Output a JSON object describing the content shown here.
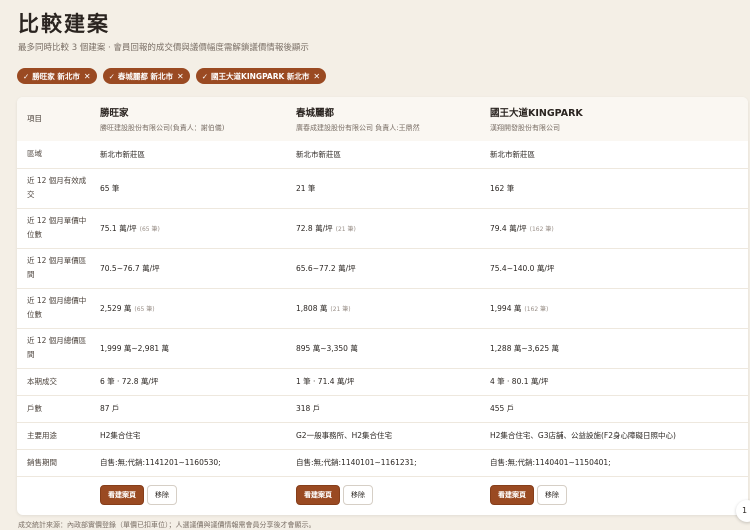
{
  "page": {
    "title": "比較建案",
    "subtitle": "最多同時比較 3 個建案 · 會員回報的成交價與議價幅度需解鎖議價情報後顯示",
    "footnote": "成交統計來源：內政部實價登錄（單價已扣車位）；人選議價與議價情報需會員分享後才會顯示。",
    "badge": "1"
  },
  "chips": [
    {
      "label": "勝旺家 新北市",
      "check": "✓",
      "close": "✕"
    },
    {
      "label": "春城麗都 新北市",
      "check": "✓",
      "close": "✕"
    },
    {
      "label": "國王大道KINGPARK 新北市",
      "check": "✓",
      "close": "✕"
    }
  ],
  "table": {
    "item_header": "項目",
    "projects": [
      {
        "name": "勝旺家",
        "developer": "勝旺建設股份有限公司(負責人：謝伯儀)"
      },
      {
        "name": "春城麗都",
        "developer": "廣春成建設股份有限公司 負責人:王鼎然"
      },
      {
        "name": "國王大道KINGPARK",
        "developer": "漢翔開發股份有限公司"
      }
    ],
    "rows": [
      {
        "label": "區域",
        "values": [
          {
            "v": "新北市新莊區"
          },
          {
            "v": "新北市新莊區"
          },
          {
            "v": "新北市新莊區"
          }
        ]
      },
      {
        "label": "近 12 個月有效成交",
        "values": [
          {
            "v": "65 筆"
          },
          {
            "v": "21 筆"
          },
          {
            "v": "162 筆"
          }
        ]
      },
      {
        "label": "近 12 個月單價中位數",
        "values": [
          {
            "v": "75.1 萬/坪",
            "n": "(65 筆)"
          },
          {
            "v": "72.8 萬/坪",
            "n": "(21 筆)"
          },
          {
            "v": "79.4 萬/坪",
            "n": "(162 筆)"
          }
        ]
      },
      {
        "label": "近 12 個月單價區間",
        "values": [
          {
            "v": "70.5~76.7 萬/坪"
          },
          {
            "v": "65.6~77.2 萬/坪"
          },
          {
            "v": "75.4~140.0 萬/坪"
          }
        ]
      },
      {
        "label": "近 12 個月總價中位數",
        "values": [
          {
            "v": "2,529 萬",
            "n": "(65 筆)"
          },
          {
            "v": "1,808 萬",
            "n": "(21 筆)"
          },
          {
            "v": "1,994 萬",
            "n": "(162 筆)"
          }
        ]
      },
      {
        "label": "近 12 個月總價區間",
        "values": [
          {
            "v": "1,999 萬~2,981 萬"
          },
          {
            "v": "895 萬~3,350 萬"
          },
          {
            "v": "1,288 萬~3,625 萬"
          }
        ]
      },
      {
        "label": "本期成交",
        "values": [
          {
            "v": "6 筆 · 72.8 萬/坪"
          },
          {
            "v": "1 筆 · 71.4 萬/坪"
          },
          {
            "v": "4 筆 · 80.1 萬/坪"
          }
        ]
      },
      {
        "label": "戶數",
        "values": [
          {
            "v": "87 戶"
          },
          {
            "v": "318 戶"
          },
          {
            "v": "455 戶"
          }
        ]
      },
      {
        "label": "主要用途",
        "values": [
          {
            "v": "H2集合住宅"
          },
          {
            "v": "G2一般事務所、H2集合住宅"
          },
          {
            "v": "H2集合住宅、G3店舖、公益設施(F2身心障礙日照中心)"
          }
        ]
      },
      {
        "label": "銷售期間",
        "values": [
          {
            "v": "自售:無;代銷:1141201~1160530;"
          },
          {
            "v": "自售:無;代銷:1140101~1161231;"
          },
          {
            "v": "自售:無;代銷:1140401~1150401;"
          }
        ]
      }
    ],
    "actions": {
      "view_label": "看建案頁",
      "remove_label": "移除"
    }
  }
}
